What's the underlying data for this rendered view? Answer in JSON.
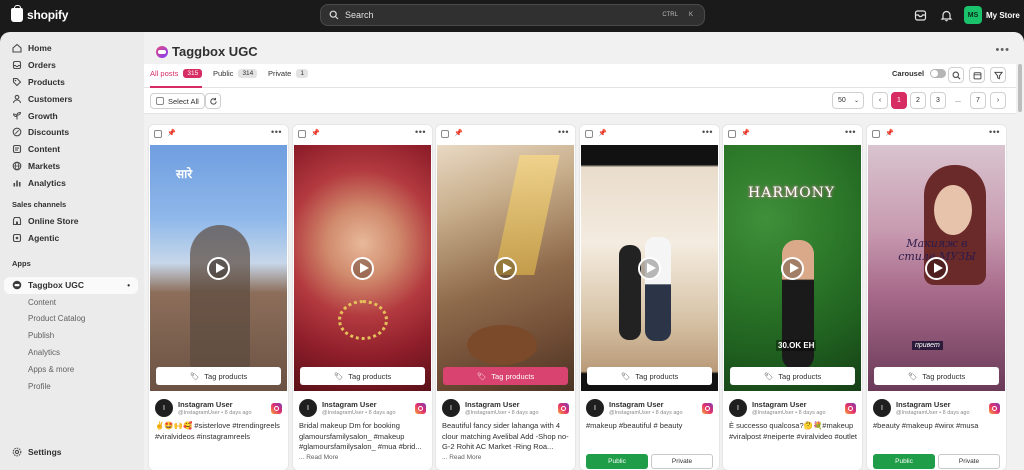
{
  "topbar": {
    "brand": "shopify",
    "search_placeholder": "Search",
    "shortcut_ctrl": "CTRL",
    "shortcut_key": "K",
    "store_initials": "MS",
    "store_name": "My Store"
  },
  "sidebar": {
    "main_items": [
      {
        "label": "Home",
        "icon": "home-icon"
      },
      {
        "label": "Orders",
        "icon": "orders-icon"
      },
      {
        "label": "Products",
        "icon": "tag-icon"
      },
      {
        "label": "Customers",
        "icon": "person-icon"
      },
      {
        "label": "Growth",
        "icon": "growth-icon"
      },
      {
        "label": "Discounts",
        "icon": "discount-icon"
      },
      {
        "label": "Content",
        "icon": "content-icon"
      },
      {
        "label": "Markets",
        "icon": "globe-icon"
      },
      {
        "label": "Analytics",
        "icon": "chart-icon"
      }
    ],
    "sales_channels_title": "Sales channels",
    "sales_channels": [
      {
        "label": "Online Store",
        "icon": "store-icon"
      },
      {
        "label": "Agentic",
        "icon": "agentic-icon"
      }
    ],
    "apps_title": "Apps",
    "app_item": {
      "label": "Taggbox UGC",
      "icon": "taggbox-icon",
      "dot": "•"
    },
    "app_subitems": [
      "Content",
      "Product Catalog",
      "Publish",
      "Analytics",
      "Apps & more",
      "Profile"
    ],
    "settings": "Settings"
  },
  "main": {
    "app_title": "Taggbox UGC",
    "tabs": [
      {
        "label": "All posts",
        "count": "315"
      },
      {
        "label": "Public",
        "count": "314"
      },
      {
        "label": "Private",
        "count": "1"
      }
    ],
    "carousel_label": "Carousel",
    "carousel_on": false,
    "select_all": "Select All",
    "per_page": "50",
    "pages": [
      "1",
      "2",
      "3",
      "...",
      "7"
    ],
    "tag_products": "Tag products",
    "read_more": "... Read More",
    "public_label": "Public",
    "private_label": "Private"
  },
  "posts": [
    {
      "user": "Instagram User",
      "handle": "@InstagramUser • 8 days ago",
      "caption": "✌️🤩🙌🥰 #sisterlove #trendingreels #viralvideos #instagramreels",
      "read_more": false,
      "tag_pink": false,
      "show_visibility": false,
      "overlay": "सारे"
    },
    {
      "user": "Instagram User",
      "handle": "@InstagramUser • 8 days ago",
      "caption": "Bridal makeup Dm for booking glamoursfamilysalon_ #makeup #glamoursfamilysalon_ #mua #brid...",
      "read_more": true,
      "tag_pink": false,
      "show_visibility": false,
      "overlay": ""
    },
    {
      "user": "Instagram User",
      "handle": "@InstagramUser • 8 days ago",
      "caption": "Beautiful fancy sider lahanga with 4 clour matching Avelibal Add -Shop no-G-2 Rohit AC Market -Ring Roa...",
      "read_more": true,
      "tag_pink": true,
      "show_visibility": false,
      "overlay": ""
    },
    {
      "user": "Instagram User",
      "handle": "@InstagramUser • 8 days ago",
      "caption": "#makeup #beautiful # beauty",
      "read_more": false,
      "tag_pink": false,
      "show_visibility": true,
      "overlay": ""
    },
    {
      "user": "Instagram User",
      "handle": "@InstagramUser • 8 days ago",
      "caption": "È successo qualcosa?🤔💐#makeup #viralpost #neiperte #viralvideo #outlet",
      "read_more": false,
      "tag_pink": false,
      "show_visibility": false,
      "overlay": "HARMONY",
      "overlay2": "30.OK EH"
    },
    {
      "user": "Instagram User",
      "handle": "@InstagramUser • 8 days ago",
      "caption": "#beauty #makeup #winx #musa",
      "read_more": false,
      "tag_pink": false,
      "show_visibility": true,
      "overlay": "Макияж в стиле МУЗЫ",
      "overlay2": "привет"
    }
  ]
}
